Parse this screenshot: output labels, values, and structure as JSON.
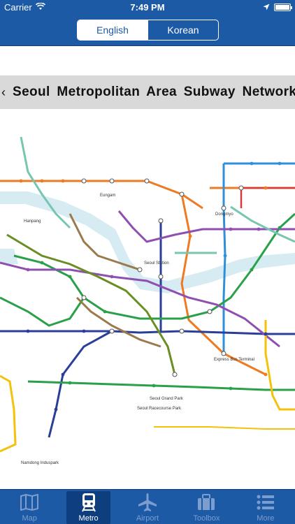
{
  "status_bar": {
    "carrier": "Carrier",
    "time": "7:49 PM",
    "battery_level": 1.0
  },
  "nav": {
    "segments": [
      {
        "label": "English",
        "active": true
      },
      {
        "label": "Korean",
        "active": false
      }
    ]
  },
  "map": {
    "title": "Seoul Metropolitan Area Subway Network",
    "station_labels": {
      "hanpang": "Hanpang",
      "eungam": "Eungam",
      "dongmyo": "Dongmyo",
      "seoul_station": "Seoul Station",
      "express_bus_terminal": "Express Bus Terminal",
      "namdong_indus": "Namdong Induspark",
      "seoul_grand_park": "Seoul Grand Park",
      "seoul_racecourse": "Seoul Racecourse Park"
    }
  },
  "tabs": [
    {
      "label": "Map",
      "icon": "map-icon",
      "active": false
    },
    {
      "label": "Metro",
      "icon": "metro-train-icon",
      "active": true
    },
    {
      "label": "Airport",
      "icon": "airplane-icon",
      "active": false
    },
    {
      "label": "Toolbox",
      "icon": "toolbox-icon",
      "active": false
    },
    {
      "label": "More",
      "icon": "more-list-icon",
      "active": false
    }
  ],
  "colors": {
    "brand_blue": "#1d5aa6",
    "line_orange": "#ee7a22",
    "line_green": "#2aa04a",
    "line_darkblue": "#2a3f99",
    "line_purple": "#8e4fb0",
    "line_brown": "#9a7a4a",
    "line_skyblue": "#2f8fd8",
    "line_olive": "#6b8e23",
    "line_yellow": "#f4c20d",
    "line_teal": "#78c6b0",
    "line_red": "#d23c3c",
    "river": "#cfe7ef"
  }
}
